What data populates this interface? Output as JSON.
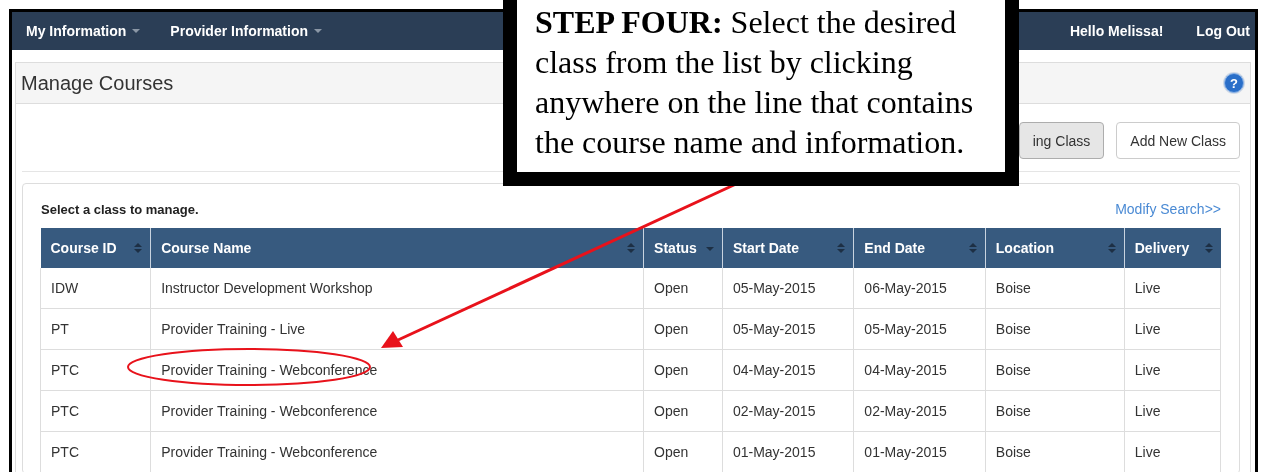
{
  "nav": {
    "left": [
      {
        "label": "My Information"
      },
      {
        "label": "Provider Information"
      }
    ],
    "greeting": "Hello Melissa!",
    "logout": "Log Out"
  },
  "panel": {
    "title": "Manage Courses",
    "help_icon": "?"
  },
  "buttons": [
    "ing Class",
    "Add New Class"
  ],
  "list": {
    "caption": "Select a class to manage.",
    "modify_link": "Modify Search>>"
  },
  "table": {
    "columns": [
      {
        "label": "Course ID",
        "sorted": false
      },
      {
        "label": "Course Name",
        "sorted": false
      },
      {
        "label": "Status",
        "sorted": true
      },
      {
        "label": "Start Date",
        "sorted": false
      },
      {
        "label": "End Date",
        "sorted": false
      },
      {
        "label": "Location",
        "sorted": false
      },
      {
        "label": "Delivery",
        "sorted": false
      }
    ],
    "rows": [
      {
        "cells": [
          "IDW",
          "Instructor Development Workshop",
          "Open",
          "05-May-2015",
          "06-May-2015",
          "Boise",
          "Live"
        ],
        "circled": false
      },
      {
        "cells": [
          "PT",
          "Provider Training - Live",
          "Open",
          "05-May-2015",
          "05-May-2015",
          "Boise",
          "Live"
        ],
        "circled": false
      },
      {
        "cells": [
          "PTC",
          "Provider Training - Webconference",
          "Open",
          "04-May-2015",
          "04-May-2015",
          "Boise",
          "Live"
        ],
        "circled": true
      },
      {
        "cells": [
          "PTC",
          "Provider Training - Webconference",
          "Open",
          "02-May-2015",
          "02-May-2015",
          "Boise",
          "Live"
        ],
        "circled": false
      },
      {
        "cells": [
          "PTC",
          "Provider Training - Webconference",
          "Open",
          "01-May-2015",
          "01-May-2015",
          "Boise",
          "Live"
        ],
        "circled": false
      }
    ]
  },
  "callout": {
    "text": "**STEP FOUR:** Select the desired class from the list by clicking anywhere on the line that contains the course name and information."
  }
}
